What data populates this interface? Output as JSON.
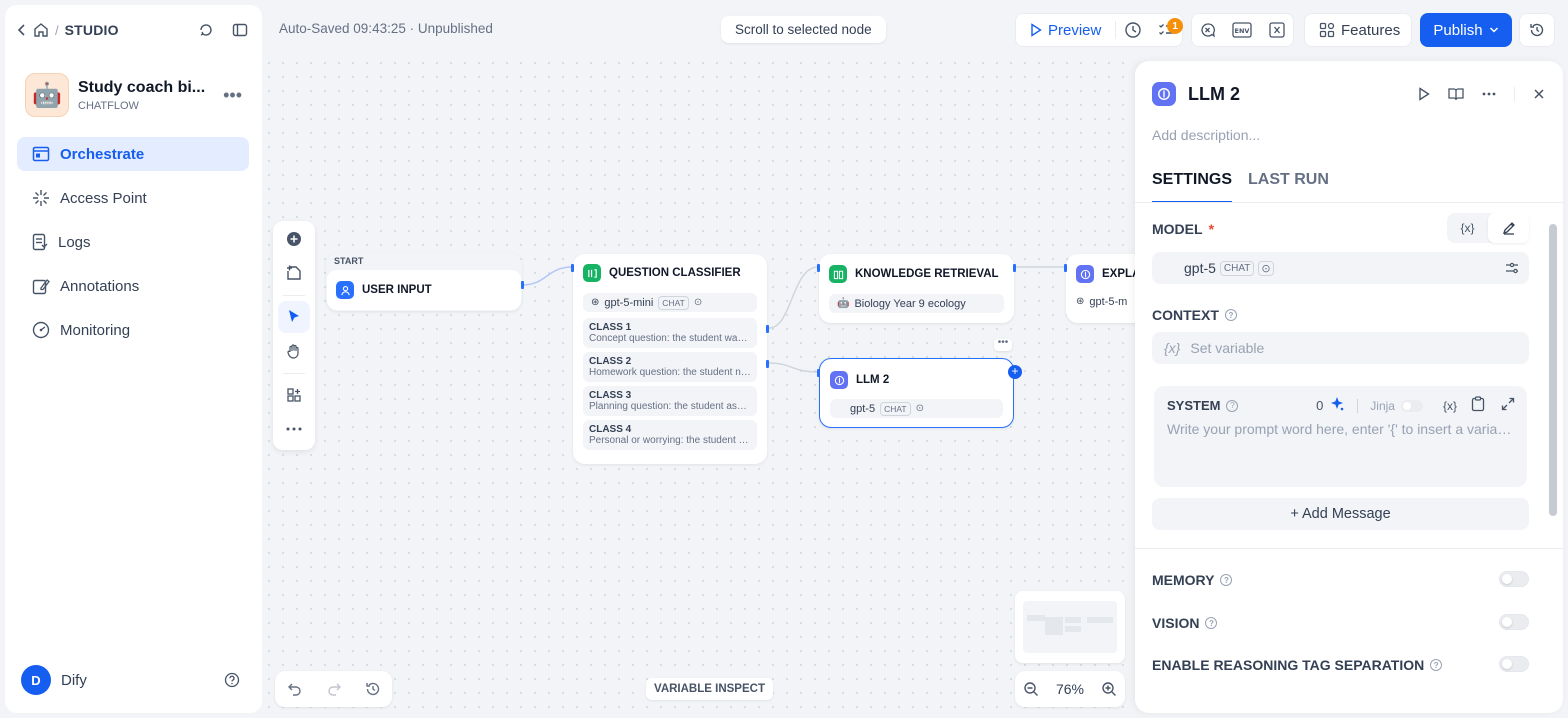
{
  "sidebar": {
    "studio_label": "STUDIO",
    "app_name": "Study coach bi...",
    "app_type": "CHATFLOW",
    "app_emoji": "🤖",
    "nav": [
      {
        "label": "Orchestrate"
      },
      {
        "label": "Access Point"
      },
      {
        "label": "Logs"
      },
      {
        "label": "Annotations"
      },
      {
        "label": "Monitoring"
      }
    ],
    "user_initial": "D",
    "user_name": "Dify"
  },
  "topbar": {
    "autosave": "Auto-Saved 09:43:25 · Unpublished",
    "scroll_pill": "Scroll to selected node",
    "preview_label": "Preview",
    "checklist_badge": "1",
    "env_label": "ENV",
    "features_label": "Features",
    "publish_label": "Publish"
  },
  "canvas": {
    "nodes": {
      "start": {
        "caption": "START",
        "title": "USER INPUT"
      },
      "classifier": {
        "title": "QUESTION CLASSIFIER",
        "model": "gpt-5-mini",
        "model_tag": "CHAT",
        "classes": [
          {
            "name": "CLASS 1",
            "desc": "Concept question: the student wants to understand a concept"
          },
          {
            "name": "CLASS 2",
            "desc": "Homework question: the student needs help with homework"
          },
          {
            "name": "CLASS 3",
            "desc": "Planning question: the student asks about study planning"
          },
          {
            "name": "CLASS 4",
            "desc": "Personal or worrying: the student shares something personal"
          }
        ]
      },
      "knowledge": {
        "title": "KNOWLEDGE RETRIEVAL",
        "dataset": "Biology Year 9 ecology"
      },
      "llm2": {
        "title": "LLM 2",
        "model": "gpt-5",
        "model_tag": "CHAT"
      },
      "explain": {
        "title": "EXPLA",
        "model": "gpt-5-m"
      }
    },
    "variable_inspect": "VARIABLE INSPECT",
    "zoom": "76%"
  },
  "panel": {
    "title": "LLM 2",
    "description_placeholder": "Add description...",
    "tabs": [
      {
        "label": "SETTINGS"
      },
      {
        "label": "LAST RUN"
      }
    ],
    "model_label": "MODEL",
    "model_required": "*",
    "var_symbol": "{x}",
    "model_name": "gpt-5",
    "model_tag": "CHAT",
    "context_label": "CONTEXT",
    "context_placeholder": "Set variable",
    "system_label": "SYSTEM",
    "system_count": "0",
    "jinja_label": "Jinja",
    "system_placeholder": "Write your prompt word here, enter '{' to insert a variable, enter '/' to insert a prompt content block",
    "add_message": "+ Add Message",
    "memory_label": "MEMORY",
    "vision_label": "VISION",
    "reasoning_label": "ENABLE REASONING TAG SEPARATION"
  },
  "colors": {
    "accent": "#155eef",
    "classifier": "#16b364",
    "knowledge": "#16b364",
    "llm": "#6172f3",
    "start": "#2970ff",
    "badge": "#f79009"
  }
}
